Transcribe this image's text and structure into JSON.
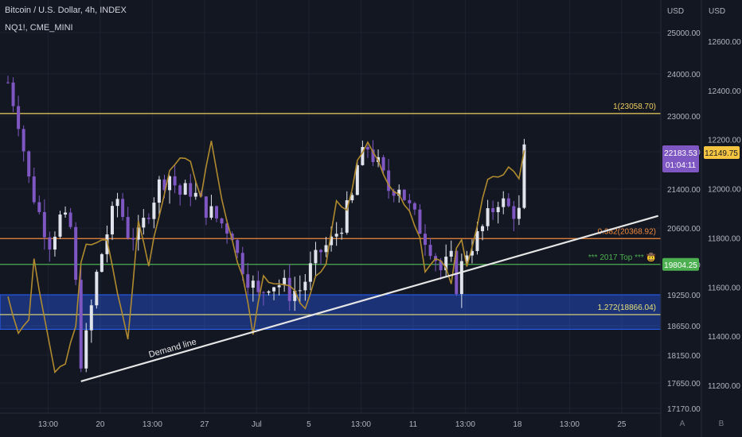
{
  "header": {
    "symbol_line": "Bitcoin / U.S. Dollar, 4h, INDEX",
    "overlay_symbol": "NQ1!, CME_MINI"
  },
  "axes": {
    "left_title": "USD",
    "right_title": "USD",
    "scale_buttons": [
      "A",
      "B"
    ]
  },
  "chart_data": {
    "type": "candlestick",
    "title": "Bitcoin / U.S. Dollar, 4h, INDEX",
    "x_ticks": [
      "13:00",
      "20",
      "13:00",
      "27",
      "Jul",
      "5",
      "13:00",
      "11",
      "13:00",
      "18",
      "13:00",
      "25"
    ],
    "x_tick_slots": [
      8,
      18,
      28,
      38,
      48,
      58,
      68,
      78,
      88,
      98,
      108,
      118
    ],
    "price_ticks": [
      25000,
      24000,
      23000,
      22200,
      21400,
      20600,
      19800,
      19250,
      18650,
      18150,
      17650,
      17170
    ],
    "nq_ticks": [
      12600,
      12400,
      12200,
      12000,
      11800,
      11600,
      11400,
      11200
    ],
    "btc_series_anchors": [
      [
        0,
        23800
      ],
      [
        2,
        22900
      ],
      [
        4,
        21600
      ],
      [
        6,
        20900
      ],
      [
        8,
        20300
      ],
      [
        10,
        20800
      ],
      [
        12,
        20600
      ],
      [
        13,
        19400
      ],
      [
        14,
        18100
      ],
      [
        15,
        18400
      ],
      [
        17,
        19600
      ],
      [
        19,
        20500
      ],
      [
        21,
        21200
      ],
      [
        23,
        20500
      ],
      [
        25,
        20400
      ],
      [
        27,
        21000
      ],
      [
        29,
        21500
      ],
      [
        31,
        21700
      ],
      [
        33,
        21300
      ],
      [
        35,
        21400
      ],
      [
        37,
        21100
      ],
      [
        39,
        20900
      ],
      [
        41,
        20700
      ],
      [
        43,
        20500
      ],
      [
        44,
        20000
      ],
      [
        46,
        19600
      ],
      [
        48,
        19200
      ],
      [
        50,
        19500
      ],
      [
        52,
        19450
      ],
      [
        54,
        19300
      ],
      [
        56,
        19350
      ],
      [
        58,
        19700
      ],
      [
        60,
        20100
      ],
      [
        62,
        20300
      ],
      [
        64,
        20700
      ],
      [
        66,
        21200
      ],
      [
        67,
        21900
      ],
      [
        69,
        22300
      ],
      [
        71,
        21900
      ],
      [
        73,
        21400
      ],
      [
        75,
        21500
      ],
      [
        77,
        21000
      ],
      [
        79,
        20600
      ],
      [
        81,
        20200
      ],
      [
        83,
        19700
      ],
      [
        85,
        19900
      ],
      [
        86,
        19450
      ],
      [
        88,
        20100
      ],
      [
        90,
        20400
      ],
      [
        92,
        20800
      ],
      [
        94,
        21200
      ],
      [
        96,
        21000
      ],
      [
        98,
        20900
      ],
      [
        99,
        22200
      ]
    ],
    "nq_series_anchors": [
      [
        0,
        11550
      ],
      [
        2,
        11420
      ],
      [
        4,
        11480
      ],
      [
        5,
        11720
      ],
      [
        7,
        11460
      ],
      [
        9,
        11250
      ],
      [
        11,
        11300
      ],
      [
        13,
        11450
      ],
      [
        14,
        11700
      ],
      [
        15,
        11780
      ],
      [
        17,
        11780
      ],
      [
        19,
        11800
      ],
      [
        21,
        11570
      ],
      [
        23,
        11400
      ],
      [
        25,
        11870
      ],
      [
        27,
        11700
      ],
      [
        29,
        11900
      ],
      [
        31,
        12080
      ],
      [
        33,
        12120
      ],
      [
        35,
        12100
      ],
      [
        37,
        11980
      ],
      [
        39,
        12180
      ],
      [
        41,
        11950
      ],
      [
        43,
        11780
      ],
      [
        45,
        11650
      ],
      [
        47,
        11420
      ],
      [
        49,
        11650
      ],
      [
        51,
        11600
      ],
      [
        53,
        11620
      ],
      [
        55,
        11580
      ],
      [
        57,
        11520
      ],
      [
        59,
        11650
      ],
      [
        61,
        11700
      ],
      [
        63,
        11950
      ],
      [
        65,
        11900
      ],
      [
        67,
        12120
      ],
      [
        69,
        12200
      ],
      [
        71,
        12120
      ],
      [
        73,
        12020
      ],
      [
        75,
        11980
      ],
      [
        77,
        11900
      ],
      [
        79,
        11800
      ],
      [
        80,
        11650
      ],
      [
        82,
        11720
      ],
      [
        84,
        11680
      ],
      [
        85,
        11620
      ],
      [
        86,
        11750
      ],
      [
        87,
        11800
      ],
      [
        88,
        11680
      ],
      [
        90,
        11850
      ],
      [
        92,
        12050
      ],
      [
        94,
        12050
      ],
      [
        96,
        12080
      ],
      [
        98,
        12050
      ],
      [
        99,
        12150
      ]
    ],
    "nq_overlay_label": "NQ1!, CME_MINI",
    "trendline": {
      "from": [
        14,
        17680
      ],
      "to": [
        125,
        20850
      ],
      "label": "Demand line"
    },
    "hlines": [
      {
        "price": 23058.7,
        "color": "#f0d060",
        "label": "1(23058.70)"
      },
      {
        "price": 20368.92,
        "color": "#f08a3c",
        "label": "0.382(20368.92)"
      },
      {
        "price": 19804.25,
        "color": "#4caf50",
        "label": "*** 2017 Top *** 🤠"
      },
      {
        "price": 18866.04,
        "color": "#e8e07a",
        "label": "1.272(18866.04)"
      }
    ],
    "demand_zone": {
      "top": 19250,
      "bottom": 18590
    },
    "last_price": {
      "value": "22183.53",
      "countdown": "01:04:11",
      "color": "#7e57c2"
    },
    "nq_last": {
      "value": "12149.75",
      "color": "#f5c542"
    },
    "price_label_2017": "19804.25"
  }
}
